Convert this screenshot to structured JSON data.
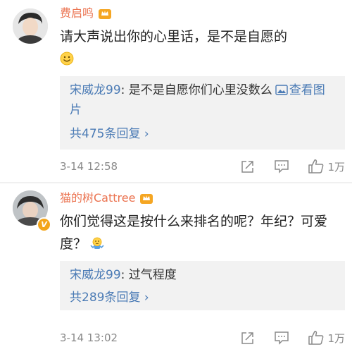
{
  "comments": [
    {
      "username": "费启鸣",
      "text": "请大声说出你的心里话，是不是自愿的",
      "text_emoji": "smile-emoji",
      "reply": {
        "user": "宋威龙99",
        "text": ": 是不是自愿你们心里没数么",
        "view_pic": "查看图片"
      },
      "reply_count": "共475条回复 ›",
      "timestamp": "3-14 12:58",
      "likes": "1万"
    },
    {
      "username": "猫的树Cattree",
      "text": "你们觉得这是按什么来排名的呢？年纪？可爱度？",
      "text_emoji": "shrug-emoji",
      "reply": {
        "user": "宋威龙99",
        "text": ": 过气程度"
      },
      "reply_count": "共289条回复 ›",
      "timestamp": "3-14 13:02",
      "likes": "1万"
    }
  ],
  "colors": {
    "username": "#eb7350",
    "link": "#4b7bb5",
    "muted": "#8a8a8a",
    "reply_bg": "#f2f2f2"
  }
}
